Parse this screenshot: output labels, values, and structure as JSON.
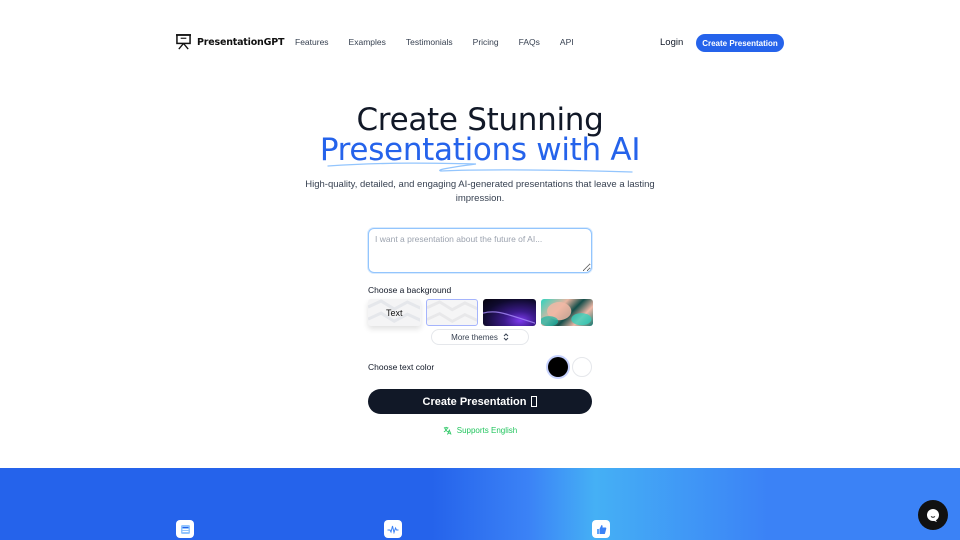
{
  "nav": {
    "brand": "PresentationGPT",
    "links": [
      "Features",
      "Examples",
      "Testimonials",
      "Pricing",
      "FAQs",
      "API"
    ],
    "login": "Login",
    "cta": "Create Presentation"
  },
  "hero": {
    "title_line1": "Create Stunning",
    "title_line2": "Presentations with AI",
    "subtitle": "High-quality, detailed, and engaging AI-generated presentations that leave a lasting impression."
  },
  "form": {
    "prompt_placeholder": "I want a presentation about the future of AI...",
    "prompt_value": "",
    "background_label": "Choose a background",
    "backgrounds": [
      {
        "name": "text-white",
        "label": "Text",
        "selected": false
      },
      {
        "name": "light-pattern",
        "label": "",
        "selected": true
      },
      {
        "name": "dark-purple-wave",
        "label": "",
        "selected": false
      },
      {
        "name": "abstract-3d",
        "label": "",
        "selected": false
      }
    ],
    "more_themes": "More themes",
    "text_color_label": "Choose text color",
    "text_colors": [
      {
        "name": "black",
        "hex": "#000000",
        "selected": true
      },
      {
        "name": "white",
        "hex": "#ffffff",
        "selected": false
      }
    ],
    "create_button": "Create Presentation",
    "supports": "Supports English"
  },
  "features": {
    "icons": [
      "document-icon",
      "activity-icon",
      "thumbs-up-icon"
    ]
  },
  "colors": {
    "accent": "#2563eb",
    "dark": "#111827",
    "success": "#22c55e"
  }
}
